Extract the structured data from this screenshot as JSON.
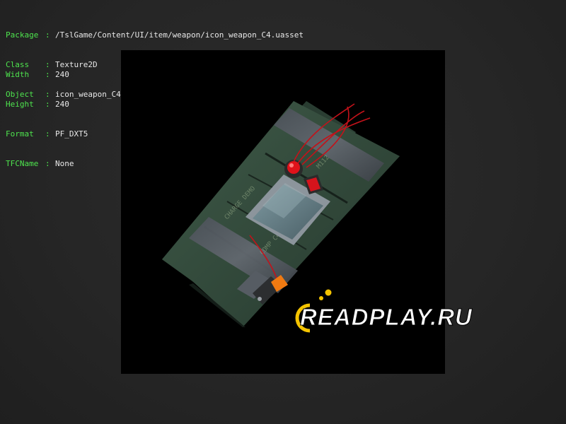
{
  "properties": {
    "package": {
      "key": "Package",
      "value": "/TslGame/Content/UI/item/weapon/icon_weapon_C4.uasset"
    },
    "class": {
      "key": "Class",
      "value": "Texture2D"
    },
    "object": {
      "key": "Object",
      "value": "icon_weapon_C4"
    },
    "width": {
      "key": "Width",
      "value": "240"
    },
    "height": {
      "key": "Height",
      "value": "240"
    },
    "format": {
      "key": "Format",
      "value": "PF_DXT5"
    },
    "tfcname": {
      "key": "TFCName",
      "value": "None"
    },
    "separator": ":"
  },
  "preview": {
    "icon": "c4-explosive-icon"
  },
  "watermark": {
    "text": "READPLAY.RU",
    "icon": "readplay-logo",
    "accent": "#f5c400"
  },
  "colors": {
    "key_color": "#4ee44e",
    "value_color": "#e8e8e8",
    "background": "#262626"
  }
}
